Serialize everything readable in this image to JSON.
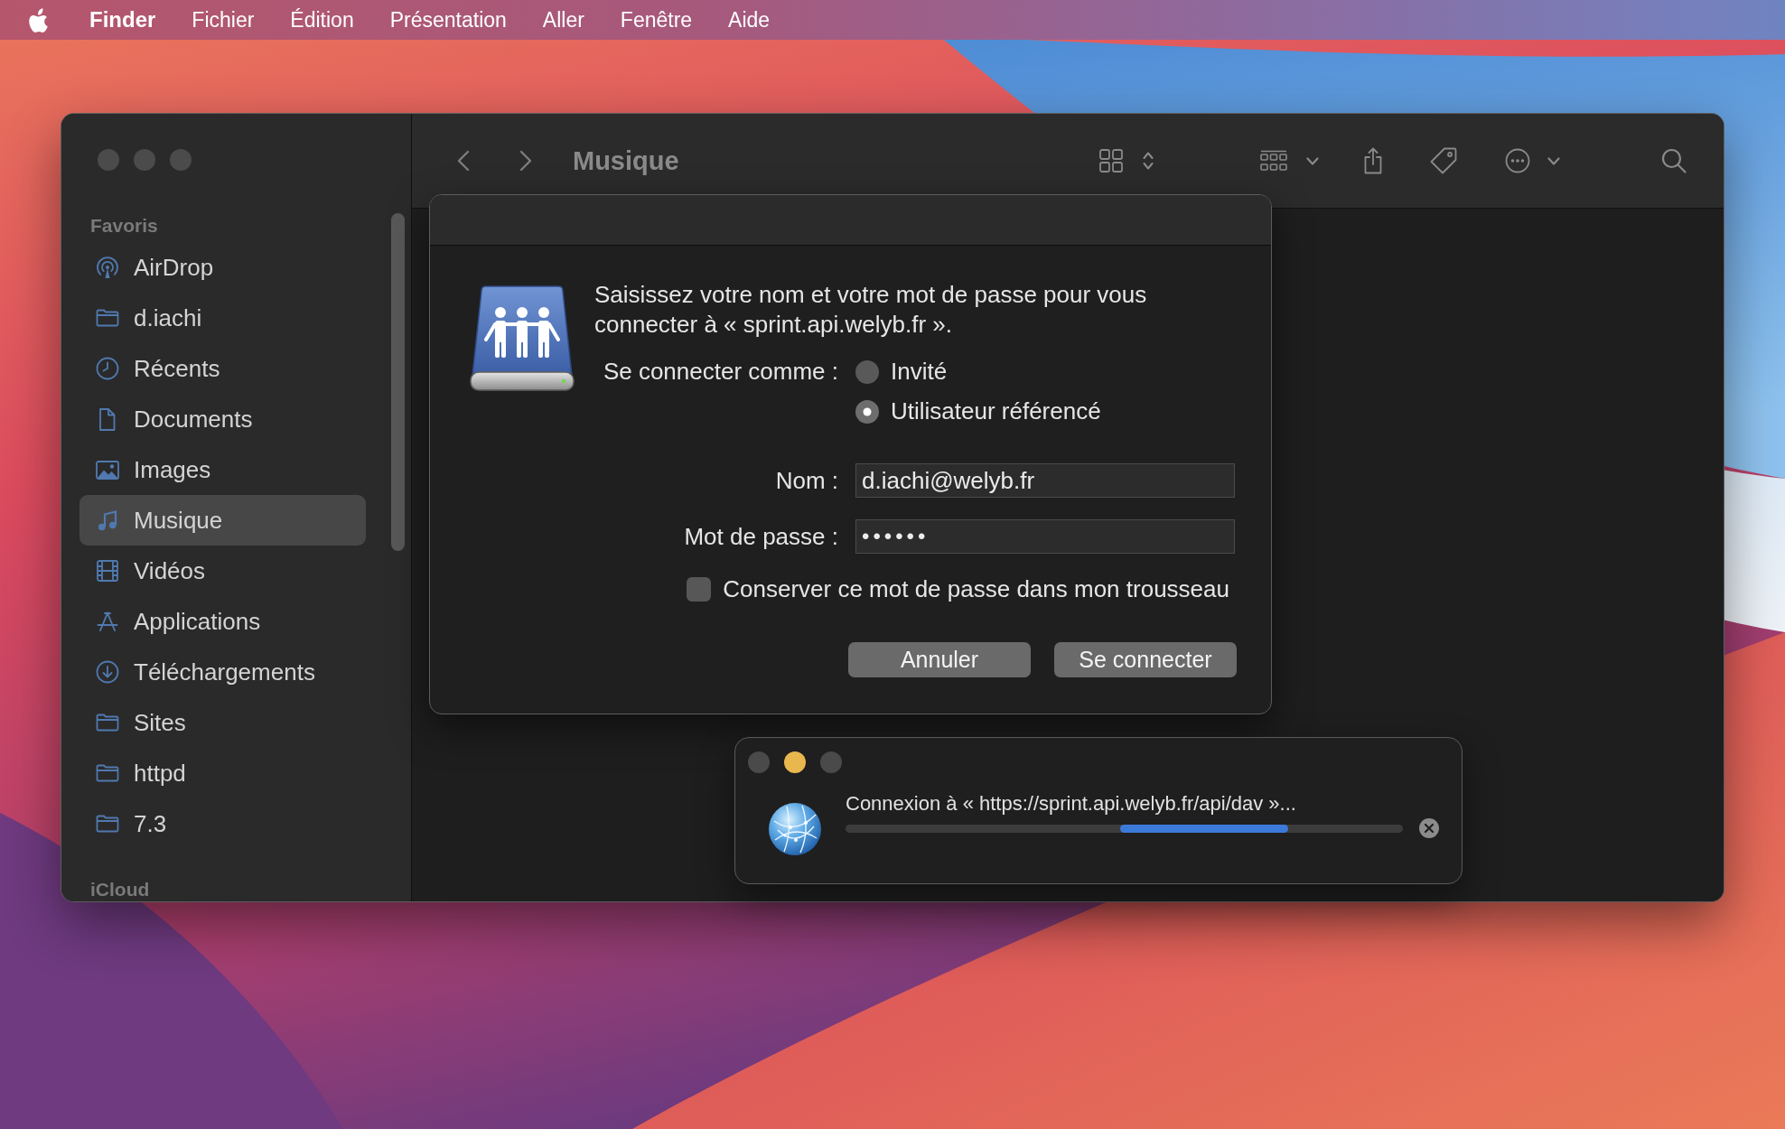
{
  "menu_bar": {
    "app_name": "Finder",
    "menus": [
      "Fichier",
      "Édition",
      "Présentation",
      "Aller",
      "Fenêtre",
      "Aide"
    ]
  },
  "finder_window": {
    "title": "Musique",
    "sidebar": {
      "sections": [
        {
          "heading": "Favoris",
          "items": [
            {
              "label": "AirDrop",
              "kind": "airdrop",
              "selected": false
            },
            {
              "label": "d.iachi",
              "kind": "folder",
              "selected": false
            },
            {
              "label": "Récents",
              "kind": "clock",
              "selected": false
            },
            {
              "label": "Documents",
              "kind": "document",
              "selected": false
            },
            {
              "label": "Images",
              "kind": "image",
              "selected": false
            },
            {
              "label": "Musique",
              "kind": "music",
              "selected": true
            },
            {
              "label": "Vidéos",
              "kind": "film",
              "selected": false
            },
            {
              "label": "Applications",
              "kind": "apps",
              "selected": false
            },
            {
              "label": "Téléchargements",
              "kind": "download",
              "selected": false
            },
            {
              "label": "Sites",
              "kind": "folder",
              "selected": false
            },
            {
              "label": "httpd",
              "kind": "folder",
              "selected": false
            },
            {
              "label": "7.3",
              "kind": "folder",
              "selected": false
            }
          ]
        },
        {
          "heading": "iCloud"
        }
      ]
    }
  },
  "login_dialog": {
    "message": "Saisissez votre nom et votre mot de passe pour vous connecter à « sprint.api.welyb.fr ».",
    "connect_as_label": "Se connecter comme :",
    "options": [
      {
        "label": "Invité",
        "selected": false
      },
      {
        "label": "Utilisateur référencé",
        "selected": true
      }
    ],
    "fields": [
      {
        "label": "Nom :",
        "value": "d.iachi@welyb.fr",
        "kind": "text"
      },
      {
        "label": "Mot de passe :",
        "value": "••••••",
        "kind": "password"
      }
    ],
    "remember": {
      "label": "Conserver ce mot de passe dans mon trousseau",
      "checked": false
    },
    "buttons": [
      "Annuler",
      "Se connecter"
    ]
  },
  "progress_window": {
    "window_controls": [
      {
        "color": "#4a4a4a"
      },
      {
        "color": "#e8b84e"
      },
      {
        "color": "#4a4a4a"
      }
    ],
    "message": "Connexion à « https://sprint.api.welyb.fr/api/dav »...",
    "indeterminate": true
  }
}
